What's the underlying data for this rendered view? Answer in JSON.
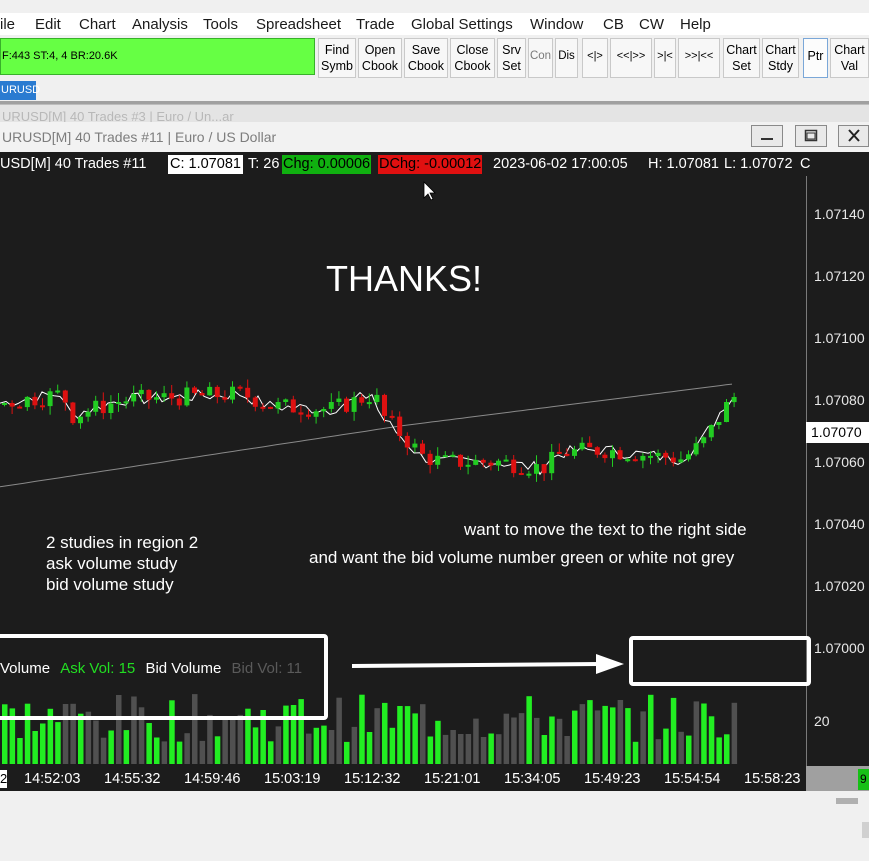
{
  "menu": {
    "items": [
      "ile",
      "Edit",
      "Chart",
      "Analysis",
      "Tools",
      "Spreadsheet",
      "Trade",
      "Global Settings",
      "Window",
      "CB",
      "CW",
      "Help"
    ]
  },
  "toolbar": {
    "status_text": "F:443  ST:4, 4  BR:20.6K",
    "buttons": [
      {
        "line1": "Find",
        "line2": "Symb"
      },
      {
        "line1": "Open",
        "line2": "Cbook"
      },
      {
        "line1": "Save",
        "line2": "Cbook"
      },
      {
        "line1": "Close",
        "line2": "Cbook"
      },
      {
        "line1": "Srv",
        "line2": "Set"
      },
      {
        "line1": "Con",
        "line2": ""
      },
      {
        "line1": "Dis",
        "line2": ""
      },
      {
        "line1": "<|>",
        "line2": ""
      },
      {
        "line1": "<<|>>",
        "line2": ""
      },
      {
        "line1": ">|<",
        "line2": ""
      },
      {
        "line1": ">>|<<",
        "line2": ""
      },
      {
        "line1": "Chart",
        "line2": "Set"
      },
      {
        "line1": "Chart",
        "line2": "Stdy"
      },
      {
        "line1": "Ptr",
        "line2": ""
      },
      {
        "line1": "Chart",
        "line2": "Val"
      }
    ]
  },
  "symbol_tab": "URUSD",
  "background_window": {
    "title": "URUSD[M]  40 Trades  #3 | Euro / Un...ar"
  },
  "chart_window": {
    "title": "URUSD[M]  40 Trades  #11 | Euro / US Dollar",
    "info": {
      "symbol": "USD[M]  40 Trades  #11",
      "close": "C: 1.07081",
      "trades": "T: 26",
      "chg": "Chg: 0.00006",
      "dchg": "DChg: -0.00012",
      "datetime": "2023-06-02  17:00:05",
      "high": "H: 1.07081",
      "low": "L: 1.07072",
      "tail": "C"
    },
    "colors": {
      "background": "#1c1c1c",
      "up": "#22cc22",
      "down": "#dd1111",
      "volume_up": "#22ee22",
      "volume_gray": "#505050",
      "chg_bg": "#10b010",
      "dchg_bg": "#e01010"
    }
  },
  "price_axis": {
    "ticks": [
      "1.07140",
      "1.07120",
      "1.07100",
      "1.07080",
      "1.07060",
      "1.07040",
      "1.07020",
      "1.07000",
      "20"
    ],
    "current_price": "1.07070",
    "corner_label": "9"
  },
  "time_axis": {
    "cut_label": "2",
    "ticks": [
      "14:52:03",
      "14:55:32",
      "14:59:46",
      "15:03:19",
      "15:12:32",
      "15:21:01",
      "15:34:05",
      "15:49:23",
      "15:54:54",
      "15:58:23"
    ]
  },
  "annotations": {
    "thanks": "THANKS!",
    "region_note": [
      "2 studies in region 2",
      "ask volume study",
      "bid volume study"
    ],
    "request_line1": "want to move the text to the right side",
    "request_line2": "and want the bid volume number green or white not grey"
  },
  "volume_labels": {
    "volume": "Volume",
    "ask_vol": "Ask Vol: 15",
    "bid_volume": "Bid Volume",
    "bid_vol": "Bid Vol: 11"
  }
}
